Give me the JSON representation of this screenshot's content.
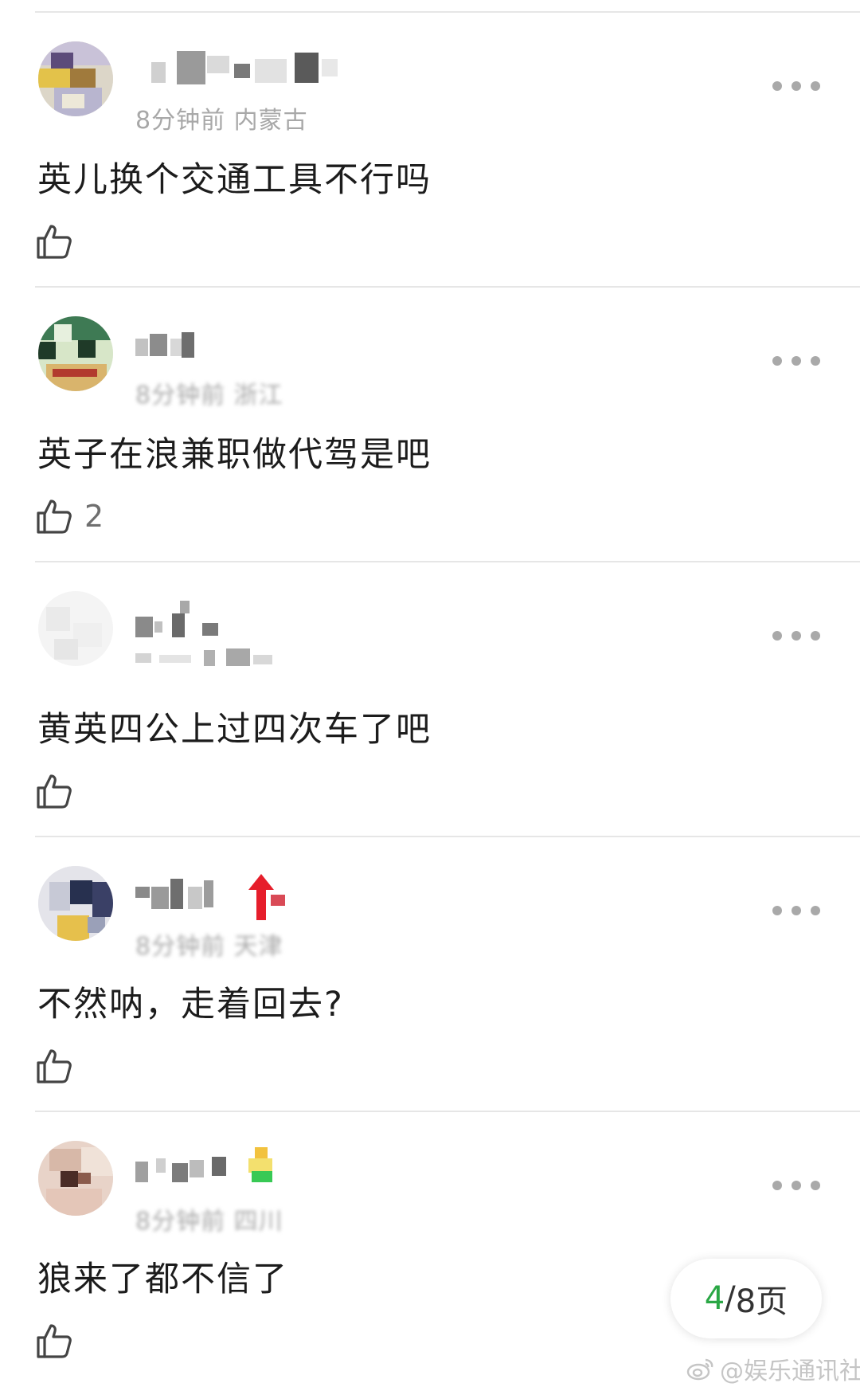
{
  "comments": [
    {
      "meta": "8分钟前 内蒙古",
      "text": "英儿换个交通工具不行吗",
      "likes": ""
    },
    {
      "meta": "8分钟前 浙江",
      "text": "英子在浪兼职做代驾是吧",
      "likes": "2"
    },
    {
      "meta": "",
      "text": "黄英四公上过四次车了吧",
      "likes": ""
    },
    {
      "meta": "8分钟前 天津",
      "text": "不然呐，走着回去?",
      "likes": ""
    },
    {
      "meta": "8分钟前 四川",
      "text": "狼来了都不信了",
      "likes": ""
    }
  ],
  "pager": {
    "current": "4",
    "separator": "/",
    "total": "8页"
  },
  "watermark": {
    "text": "@娱乐通讯社"
  },
  "icons": {
    "like": "thumbs-up-icon",
    "more": "more-dots-icon",
    "weibo": "weibo-logo-icon"
  },
  "colors": {
    "accent": "#2aa745",
    "meta": "#a8a8a8",
    "divider": "#e6e6e6"
  }
}
